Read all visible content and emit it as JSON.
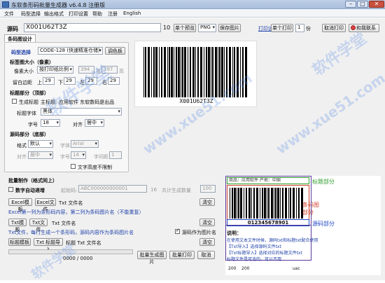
{
  "window": {
    "title": "东软条形码批量生成器 v6.4.8 注册版",
    "minimize": "–",
    "maximize": "□",
    "close": "✕"
  },
  "menu": [
    "文件",
    "码型选择",
    "输出格式",
    "打印设置",
    "帮助",
    "注册",
    "English"
  ],
  "toolbar": {
    "source_label": "源码",
    "source_value": "X001U62T3Z",
    "font_size": "10",
    "preview_button": "单个预览",
    "format_value": "PNG",
    "save_button": "保存图片",
    "print_settings_link": "打印设置",
    "print_one_button": "单个打印",
    "copies": "1",
    "copies_unit": "份",
    "cancel_print_button": "取消打印",
    "contact_button": "和我联系"
  },
  "design": {
    "tab_label": "条码图设计",
    "symbology_label": "码型选择",
    "symbology_value": "CODE-128 (快速精准仓储)",
    "symbology_button": "调色板",
    "size_section": "标签图大小（像素）",
    "pixel_size_label": "像素大小",
    "pixel_size_mode": "按打印纸比例",
    "width": "394",
    "width_unit": "宽",
    "height": "197",
    "height_unit": "高",
    "margin_label": "留白边距",
    "margin_top_label": "上",
    "margin_top": "29",
    "margin_bottom_label": "下",
    "margin_bottom": "29",
    "margin_left_label": "左",
    "margin_left": "29",
    "margin_right_label": "右",
    "margin_right": "29",
    "title_section": "标题部分（顶部）",
    "gen_title_label": "生成标题",
    "main_title_label": "主标题:",
    "main_title_value": "应用软件 东软数码是出品",
    "title_font_label": "标题字体",
    "title_font_value": "黑体",
    "title_size_label": "字号",
    "title_size_value": "18",
    "title_align_label": "对齐",
    "title_align_value": "居中",
    "source_section": "源码部分（底部）",
    "format_label": "格式",
    "format_value": "默认",
    "font_label": "字体",
    "font_value": "Arial",
    "align_label": "对齐",
    "align_value": "居中",
    "size_label": "字号",
    "size_value": "14",
    "spacing_label": "字间距",
    "spacing_value": "1",
    "unlimited_label": "文字高度不限制"
  },
  "preview": {
    "barcode_text": "X001U62T3Z"
  },
  "batch": {
    "section": "批量制作（格式同上）",
    "auto_increment_label": "数字自动递增",
    "start_label": "起始码:",
    "start_value": "ABC000000000001",
    "digits": "16",
    "count_label": "共计生成数量",
    "count_value": "100",
    "excel_template_button": "Excel模板",
    "excel_file_button": "Excel文件",
    "excel_filename_label": "Txt 文件名",
    "clear_button_1": "清空",
    "excel_note": "Excel第一列为条形码内容，第二列为条码图片名（不能重复）",
    "txt_template_button": "Txt模板",
    "txt_file_button": "Txt文件",
    "txt_filename_label": "Txt 文件名",
    "clear_button_2": "清空",
    "txt_note": "Txt文件，每行生成一个条形码，源码内容作为条码图片名",
    "source_as_name_label": "源码作为图片名",
    "title_template_button": "标题模板",
    "title_import_button": "Txt 标题导入",
    "title_txt_label": "标题 Txt 文件名",
    "clear_button_3": "清空",
    "progress_text": "0000 / 0000",
    "progress_percent": 0,
    "batch_gen_button": "批量生成图片",
    "batch_print_button": "批量打印",
    "cancel_button": "取消"
  },
  "sample": {
    "title_text": "商品：应用软件  产地：中国",
    "title_tag": "标题部分",
    "barcode_tag_1": "条码图",
    "barcode_tag_2": "部分",
    "number": "012345678901",
    "number_tag": "源码部分",
    "help_header": "说明：",
    "help_lines": [
      "在使用文本文件时候，源码txt和标题txt配合使用",
      "【Txt导入】选择源码文件txt",
      "【Txt标题导入】选择对应的标题文件txt",
      "标题文件是可选的，可以不用"
    ],
    "footer_w": "200",
    "footer_h": "200",
    "footer_extra": "uac"
  },
  "colors": {
    "accent_blue": "#1d3fa8",
    "title_green": "#2f9e2f",
    "barcode_red": "#d0402a",
    "source_blue": "#2448c4",
    "box_purple": "#5a3a9a"
  },
  "watermark": {
    "text_cn": "软件学堂",
    "text_url": "www.xue51.com"
  }
}
